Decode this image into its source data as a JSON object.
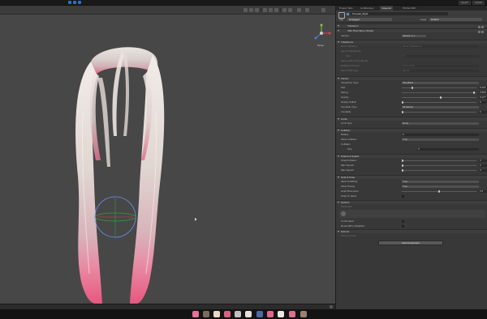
{
  "topbar": {
    "account_label": "Layers",
    "layout_label": "Layout"
  },
  "scene": {
    "gizmo_label": "Persp"
  },
  "inspector": {
    "tabs": [
      {
        "label": "Project Tabs"
      },
      {
        "label": "Ai AIDenkey"
      },
      {
        "label": "Inspector"
      },
      {
        "label": "PiCSet SDK"
      }
    ],
    "object_name": "Ponytail_Right",
    "tag_label": "Tag",
    "tag_value": "Untagged",
    "layer_label": "Layer",
    "layer_value": "Default",
    "components": [
      {
        "label": "Transform"
      },
      {
        "label": "VRC Phys Bone (Script)"
      }
    ],
    "version_label": "Version",
    "version_value": "Version 1.1",
    "sections": {
      "transforms": {
        "title": "Transforms",
        "rows": [
          {
            "label": "Root Transform",
            "value": "None (Transform)"
          },
          {
            "label": "Ignore Transforms",
            "value": ""
          },
          {
            "label": "Size",
            "value": "0"
          },
          {
            "label": "Ignore Other Phys Bones",
            "value": ""
          },
          {
            "label": "Endpoint Position",
            "value": "X 0   Y 0   Z 0"
          },
          {
            "label": "Multi Child Type",
            "value": "Ignore"
          }
        ]
      },
      "forces": {
        "title": "Forces",
        "integration_label": "Integration Type",
        "integration_value": "Simplified",
        "pull_label": "Pull",
        "pull_value": "0.116",
        "spring_label": "Spring",
        "spring_value": "0.956",
        "gravity_label": "Gravity",
        "gravity_value": "0.177",
        "gravity_falloff_label": "Gravity Falloff",
        "gravity_falloff_value": "0",
        "immobile_type_label": "Immobile Type",
        "immobile_type_value": "All Motion",
        "immobile_label": "Immobile",
        "immobile_value": "0"
      },
      "limits": {
        "title": "Limits",
        "limit_type_label": "Limit Type",
        "limit_type_value": "None"
      },
      "collision": {
        "title": "Collision",
        "radius_label": "Radius",
        "radius_value": "0",
        "allow_collision_label": "Allow Collision",
        "allow_collision_value": "True",
        "colliders_label": "Colliders",
        "size_label": "Size",
        "size_value": "0"
      },
      "stretch": {
        "title": "Stretch & Squish",
        "stretch_motion_label": "Stretch Motion",
        "stretch_motion_value": "0",
        "max_stretch_label": "Max Stretch",
        "max_stretch_value": "0",
        "max_squish_label": "Max Squish",
        "max_squish_value": "0"
      },
      "grab": {
        "title": "Grab & Pose",
        "allow_grabbing_label": "Allow Grabbing",
        "allow_grabbing_value": "True",
        "allow_posing_label": "Allow Posing",
        "allow_posing_value": "True",
        "grab_movement_label": "Grab Movement",
        "grab_movement_value": "0.5",
        "snap_label": "Snap To Hand"
      },
      "options": {
        "title": "Options",
        "parameter_label": "Parameter",
        "is_animated_label": "Is Animated",
        "reset_label": "Reset When Disabled"
      },
      "gizmos": {
        "title": "Gizmos",
        "show_gizmos_label": "Show Gizmos"
      }
    },
    "add_component_label": "Add Component"
  },
  "accent": "#2f6cd6",
  "hair_tip_color": "#e8577f"
}
